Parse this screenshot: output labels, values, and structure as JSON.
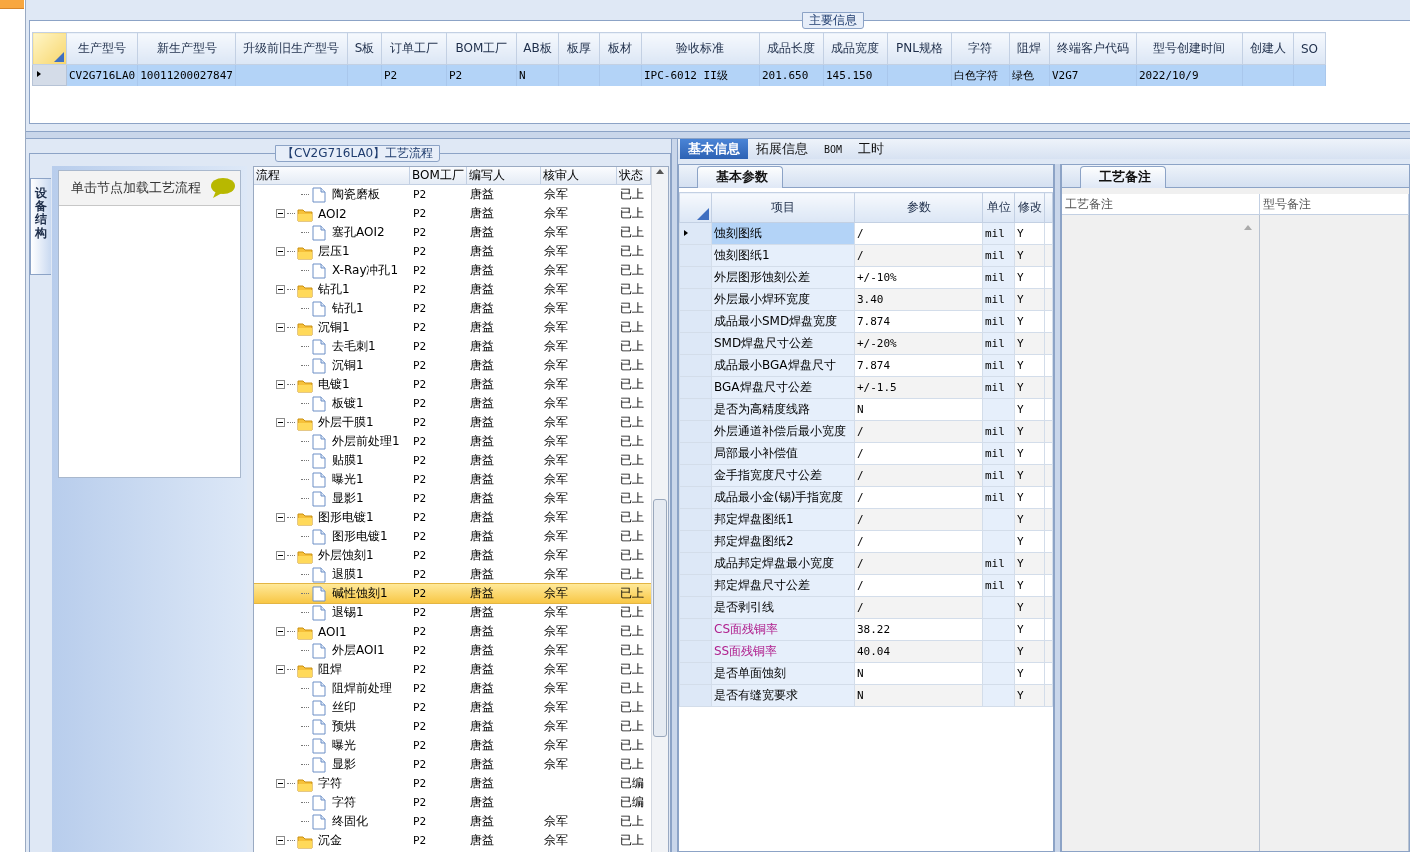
{
  "main_info": {
    "title": "主要信息",
    "columns": [
      "生产型号",
      "新生产型号",
      "升级前旧生产型号",
      "S板",
      "订单工厂",
      "BOM工厂",
      "AB板",
      "板厚",
      "板材",
      "验收标准",
      "成品长度",
      "成品宽度",
      "PNL规格",
      "字符",
      "阻焊",
      "终端客户代码",
      "型号创建时间",
      "创建人",
      "SO"
    ],
    "rows": [
      {
        "selected": true,
        "cells": [
          "CV2G716LA0",
          "10011200027847",
          null,
          null,
          "P2",
          "P2",
          "N",
          null,
          null,
          "IPC-6012 II级",
          "201.650",
          "145.150",
          null,
          "白色字符",
          "绿色",
          "V2G7",
          "2022/10/9",
          null,
          null
        ]
      }
    ]
  },
  "process_flow": {
    "title": "【CV2G716LA0】工艺流程",
    "side_tab": "设备结构",
    "hint": "单击节点加载工艺流程",
    "columns": [
      "流程",
      "BOM工厂",
      "编写人",
      "核审人",
      "状态"
    ],
    "rows": [
      {
        "kind": "continuation",
        "children": [
          {
            "name": "陶瓷磨板",
            "bom": "P2",
            "writer": "唐益",
            "reviewer": "佘军",
            "status": "已上",
            "selected": false
          }
        ]
      },
      {
        "kind": "folder",
        "name": "AOI2",
        "bom": "P2",
        "writer": "唐益",
        "reviewer": "佘军",
        "status": "已上",
        "selected": false,
        "expanded": true,
        "children": [
          {
            "name": "塞孔AOI2",
            "bom": "P2",
            "writer": "唐益",
            "reviewer": "佘军",
            "status": "已上",
            "selected": false
          }
        ]
      },
      {
        "kind": "folder",
        "name": "层压1",
        "bom": "P2",
        "writer": "唐益",
        "reviewer": "佘军",
        "status": "已上",
        "selected": false,
        "expanded": true,
        "children": [
          {
            "name": "X-Ray冲孔1",
            "bom": "P2",
            "writer": "唐益",
            "reviewer": "佘军",
            "status": "已上",
            "selected": false
          }
        ]
      },
      {
        "kind": "folder",
        "name": "钻孔1",
        "bom": "P2",
        "writer": "唐益",
        "reviewer": "佘军",
        "status": "已上",
        "selected": false,
        "expanded": true,
        "children": [
          {
            "name": "钻孔1",
            "bom": "P2",
            "writer": "唐益",
            "reviewer": "佘军",
            "status": "已上",
            "selected": false
          }
        ]
      },
      {
        "kind": "folder",
        "name": "沉铜1",
        "bom": "P2",
        "writer": "唐益",
        "reviewer": "佘军",
        "status": "已上",
        "selected": false,
        "expanded": true,
        "children": [
          {
            "name": "去毛刺1",
            "bom": "P2",
            "writer": "唐益",
            "reviewer": "佘军",
            "status": "已上",
            "selected": false
          },
          {
            "name": "沉铜1",
            "bom": "P2",
            "writer": "唐益",
            "reviewer": "佘军",
            "status": "已上",
            "selected": false
          }
        ]
      },
      {
        "kind": "folder",
        "name": "电镀1",
        "bom": "P2",
        "writer": "唐益",
        "reviewer": "佘军",
        "status": "已上",
        "selected": false,
        "expanded": true,
        "children": [
          {
            "name": "板镀1",
            "bom": "P2",
            "writer": "唐益",
            "reviewer": "佘军",
            "status": "已上",
            "selected": false
          }
        ]
      },
      {
        "kind": "folder",
        "name": "外层干膜1",
        "bom": "P2",
        "writer": "唐益",
        "reviewer": "佘军",
        "status": "已上",
        "selected": false,
        "expanded": true,
        "children": [
          {
            "name": "外层前处理1",
            "bom": "P2",
            "writer": "唐益",
            "reviewer": "佘军",
            "status": "已上",
            "selected": false
          },
          {
            "name": "贴膜1",
            "bom": "P2",
            "writer": "唐益",
            "reviewer": "佘军",
            "status": "已上",
            "selected": false
          },
          {
            "name": "曝光1",
            "bom": "P2",
            "writer": "唐益",
            "reviewer": "佘军",
            "status": "已上",
            "selected": false
          },
          {
            "name": "显影1",
            "bom": "P2",
            "writer": "唐益",
            "reviewer": "佘军",
            "status": "已上",
            "selected": false
          }
        ]
      },
      {
        "kind": "folder",
        "name": "图形电镀1",
        "bom": "P2",
        "writer": "唐益",
        "reviewer": "佘军",
        "status": "已上",
        "selected": false,
        "expanded": true,
        "children": [
          {
            "name": "图形电镀1",
            "bom": "P2",
            "writer": "唐益",
            "reviewer": "佘军",
            "status": "已上",
            "selected": false
          }
        ]
      },
      {
        "kind": "folder",
        "name": "外层蚀刻1",
        "bom": "P2",
        "writer": "唐益",
        "reviewer": "佘军",
        "status": "已上",
        "selected": false,
        "expanded": true,
        "children": [
          {
            "name": "退膜1",
            "bom": "P2",
            "writer": "唐益",
            "reviewer": "佘军",
            "status": "已上",
            "selected": false
          },
          {
            "name": "碱性蚀刻1",
            "bom": "P2",
            "writer": "唐益",
            "reviewer": "佘军",
            "status": "已上",
            "selected": true
          },
          {
            "name": "退锡1",
            "bom": "P2",
            "writer": "唐益",
            "reviewer": "佘军",
            "status": "已上",
            "selected": false
          }
        ]
      },
      {
        "kind": "folder",
        "name": "AOI1",
        "bom": "P2",
        "writer": "唐益",
        "reviewer": "佘军",
        "status": "已上",
        "selected": false,
        "expanded": true,
        "children": [
          {
            "name": "外层AOI1",
            "bom": "P2",
            "writer": "唐益",
            "reviewer": "佘军",
            "status": "已上",
            "selected": false
          }
        ]
      },
      {
        "kind": "folder",
        "name": "阻焊",
        "bom": "P2",
        "writer": "唐益",
        "reviewer": "佘军",
        "status": "已上",
        "selected": false,
        "expanded": true,
        "children": [
          {
            "name": "阻焊前处理",
            "bom": "P2",
            "writer": "唐益",
            "reviewer": "佘军",
            "status": "已上",
            "selected": false
          },
          {
            "name": "丝印",
            "bom": "P2",
            "writer": "唐益",
            "reviewer": "佘军",
            "status": "已上",
            "selected": false
          },
          {
            "name": "预烘",
            "bom": "P2",
            "writer": "唐益",
            "reviewer": "佘军",
            "status": "已上",
            "selected": false
          },
          {
            "name": "曝光",
            "bom": "P2",
            "writer": "唐益",
            "reviewer": "佘军",
            "status": "已上",
            "selected": false
          },
          {
            "name": "显影",
            "bom": "P2",
            "writer": "唐益",
            "reviewer": "佘军",
            "status": "已上",
            "selected": false
          }
        ]
      },
      {
        "kind": "folder",
        "name": "字符",
        "bom": "P2",
        "writer": "唐益",
        "status": "已编",
        "selected": false,
        "expanded": true,
        "children": [
          {
            "name": "字符",
            "bom": "P2",
            "writer": "唐益",
            "status": "已编",
            "selected": false
          },
          {
            "name": "终固化",
            "bom": "P2",
            "writer": "唐益",
            "reviewer": "佘军",
            "status": "已上",
            "selected": false
          }
        ]
      },
      {
        "kind": "folder",
        "name": "沉金",
        "bom": "P2",
        "writer": "唐益",
        "reviewer": "佘军",
        "status": "已上",
        "selected": false,
        "expanded": true
      }
    ]
  },
  "detail_tabs": [
    {
      "label": "基本信息",
      "selected": true
    },
    {
      "label": "拓展信息",
      "selected": false
    },
    {
      "label": "BOM",
      "selected": false
    },
    {
      "label": "工时",
      "selected": false
    }
  ],
  "basic_params": {
    "tab": "基本参数",
    "columns": [
      "项目",
      "参数",
      "单位",
      "修改"
    ],
    "rows": [
      {
        "item": "蚀刻图纸",
        "value": "/",
        "unit": "mil",
        "modify": "Y",
        "selected": true,
        "flagged": false
      },
      {
        "item": "蚀刻图纸1",
        "value": "/",
        "unit": "mil",
        "modify": "Y",
        "selected": false,
        "flagged": false
      },
      {
        "item": "外层图形蚀刻公差",
        "value": "+/-10%",
        "unit": "mil",
        "modify": "Y",
        "selected": false,
        "flagged": false
      },
      {
        "item": "外层最小焊环宽度",
        "value": "3.40",
        "unit": "mil",
        "modify": "Y",
        "selected": false,
        "flagged": false
      },
      {
        "item": "成品最小SMD焊盘宽度",
        "value": "7.874",
        "unit": "mil",
        "modify": "Y",
        "selected": false,
        "flagged": false
      },
      {
        "item": "SMD焊盘尺寸公差",
        "value": "+/-20%",
        "unit": "mil",
        "modify": "Y",
        "selected": false,
        "flagged": false
      },
      {
        "item": "成品最小BGA焊盘尺寸",
        "value": "7.874",
        "unit": "mil",
        "modify": "Y",
        "selected": false,
        "flagged": false
      },
      {
        "item": "BGA焊盘尺寸公差",
        "value": "+/-1.5",
        "unit": "mil",
        "modify": "Y",
        "selected": false,
        "flagged": false
      },
      {
        "item": "是否为高精度线路",
        "value": "N",
        "modify": "Y",
        "selected": false,
        "flagged": false
      },
      {
        "item": "外层通道补偿后最小宽度",
        "value": "/",
        "unit": "mil",
        "modify": "Y",
        "selected": false,
        "flagged": false
      },
      {
        "item": "局部最小补偿值",
        "value": "/",
        "unit": "mil",
        "modify": "Y",
        "selected": false,
        "flagged": false
      },
      {
        "item": "金手指宽度尺寸公差",
        "value": "/",
        "unit": "mil",
        "modify": "Y",
        "selected": false,
        "flagged": false
      },
      {
        "item": "成品最小金(锡)手指宽度",
        "value": "/",
        "unit": "mil",
        "modify": "Y",
        "selected": false,
        "flagged": false
      },
      {
        "item": "邦定焊盘图纸1",
        "value": "/",
        "modify": "Y",
        "selected": false,
        "flagged": false
      },
      {
        "item": "邦定焊盘图纸2",
        "value": "/",
        "modify": "Y",
        "selected": false,
        "flagged": false
      },
      {
        "item": "成品邦定焊盘最小宽度",
        "value": "/",
        "unit": "mil",
        "modify": "Y",
        "selected": false,
        "flagged": false
      },
      {
        "item": "邦定焊盘尺寸公差",
        "value": "/",
        "unit": "mil",
        "modify": "Y",
        "selected": false,
        "flagged": false
      },
      {
        "item": "是否剥引线",
        "value": "/",
        "modify": "Y",
        "selected": false,
        "flagged": false
      },
      {
        "item": "CS面残铜率",
        "value": "38.22",
        "modify": "Y",
        "selected": false,
        "flagged": true
      },
      {
        "item": "SS面残铜率",
        "value": "40.04",
        "modify": "Y",
        "selected": false,
        "flagged": true
      },
      {
        "item": "是否单面蚀刻",
        "value": "N",
        "modify": "Y",
        "selected": false,
        "flagged": false
      },
      {
        "item": "是否有缝宽要求",
        "value": "N",
        "modify": "Y",
        "selected": false,
        "flagged": false
      }
    ]
  },
  "process_remarks": {
    "tab": "工艺备注",
    "columns": [
      "工艺备注",
      "型号备注"
    ]
  }
}
